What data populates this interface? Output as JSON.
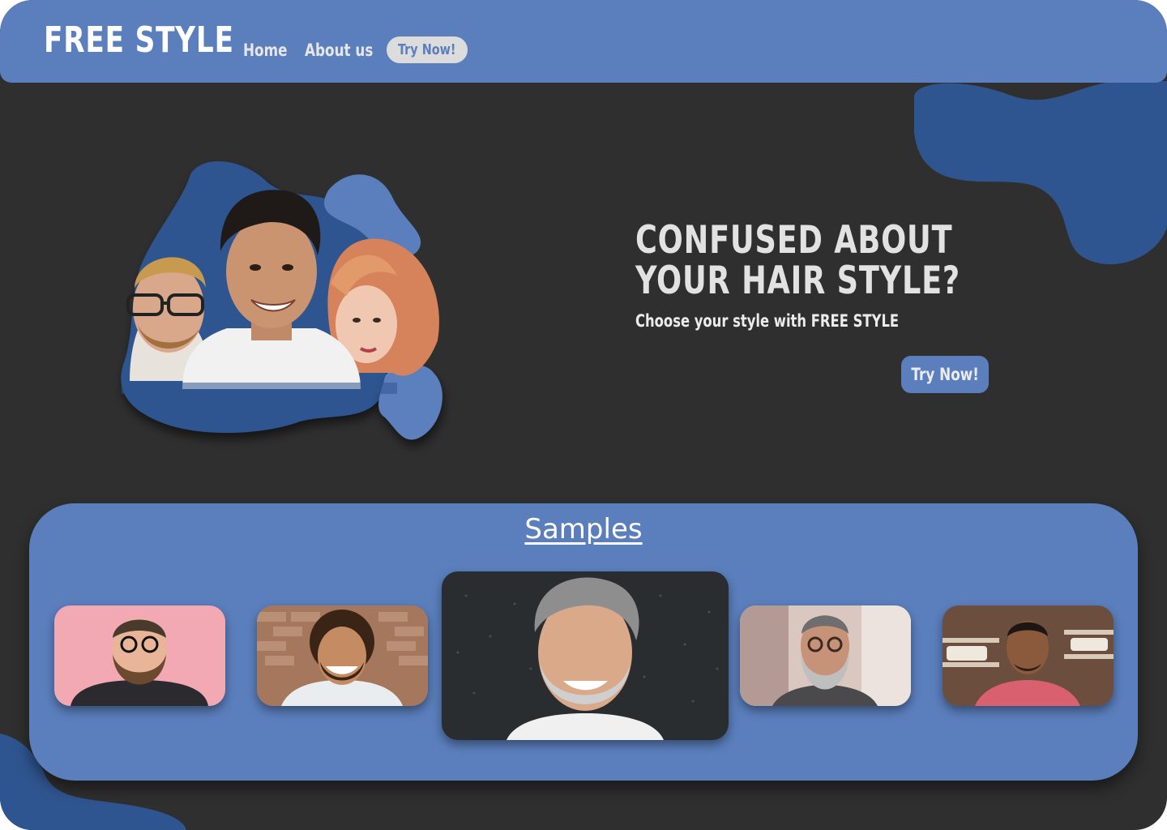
{
  "header": {
    "logo": "FREE STYLE",
    "nav": [
      {
        "label": "Home"
      },
      {
        "label": "About us"
      }
    ],
    "cta_label": "Try Now!"
  },
  "hero": {
    "title": "CONFUSED ABOUT YOUR HAIR STYLE?",
    "subtitle": "Choose your style with FREE STYLE",
    "cta_label": "Try Now!"
  },
  "samples": {
    "title": "Samples",
    "items": [
      {
        "name": "sample-bearded-man-pink"
      },
      {
        "name": "sample-curly-hair-man"
      },
      {
        "name": "sample-grey-hair-man"
      },
      {
        "name": "sample-grey-beard-man"
      },
      {
        "name": "sample-man-pink-shirt"
      }
    ]
  },
  "colors": {
    "brand": "#5b7fbd",
    "brand_dark": "#2f5590",
    "background": "#2f2f2f",
    "text_light": "#e2e2e2"
  }
}
